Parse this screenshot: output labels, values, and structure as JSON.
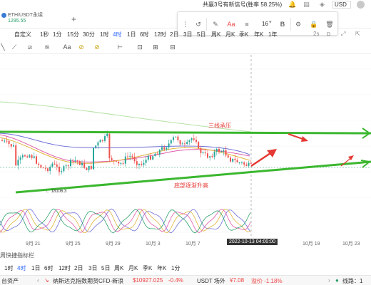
{
  "topbar": {
    "notice": "共赢3号有新信号(胜率 58.25%)",
    "currency": "USD"
  },
  "tabs": {
    "pair": "ETH/USDT永续",
    "price": "1295.55",
    "add": "+"
  },
  "float_toolbar": {
    "font_size": "16",
    "bold": "B",
    "text_tool": "Aa"
  },
  "intervals": {
    "custom": "自定义",
    "items": [
      "1秒",
      "1分",
      "5分",
      "15分",
      "30分",
      "1时",
      "4时",
      "1日",
      "6时",
      "12时",
      "2日",
      "3日",
      "5日",
      "周K",
      "月K",
      "季K",
      "年K",
      "1年"
    ],
    "active": "4时",
    "right_label": "2s",
    "text_tool": "Aa"
  },
  "annotations": {
    "top_line": "三线承压",
    "bottom_line": "底部逐渐升高",
    "low_price": "← 18106.3"
  },
  "xaxis": {
    "ticks": [
      "9月 21",
      "9月 25",
      "9月 29",
      "10月 3",
      "10月 7",
      "10月 19",
      "10月 23"
    ],
    "crosshair_date": "2022-10-13 04:00:00"
  },
  "quickbar": {
    "label": "周快捷指标栏"
  },
  "intervals2": {
    "items": [
      "1时",
      "4时",
      "1日",
      "6时",
      "12时",
      "2日",
      "3日",
      "5日",
      "周K",
      "月K",
      "季K",
      "年K",
      "1分"
    ],
    "active": "4时"
  },
  "ticker": {
    "left": "台资产",
    "instrument": "纳斯达克指数期货CFD-新浪",
    "price": "$10927.025",
    "change": "-0.4%",
    "pair2": "USDT 场外",
    "price2": "¥7.08",
    "premium": "溢价 -1.18%",
    "route": "线路：1"
  },
  "colors": {
    "green_line": "#3bb72f",
    "annotation_red": "#e53935",
    "active_blue": "#2962ff",
    "up": "#26a69a",
    "down": "#ef5350"
  },
  "chart_data": {
    "type": "candlestick",
    "x": [
      "9月 21",
      "9月 25",
      "9月 29",
      "10月 3",
      "10月 7",
      "10月 19",
      "10月 23"
    ],
    "annotations": [
      "三线承压",
      "底部逐渐升高"
    ],
    "low_marker": "18106.3",
    "crosshair": "2022-10-13 04:00:00",
    "grid": true
  }
}
